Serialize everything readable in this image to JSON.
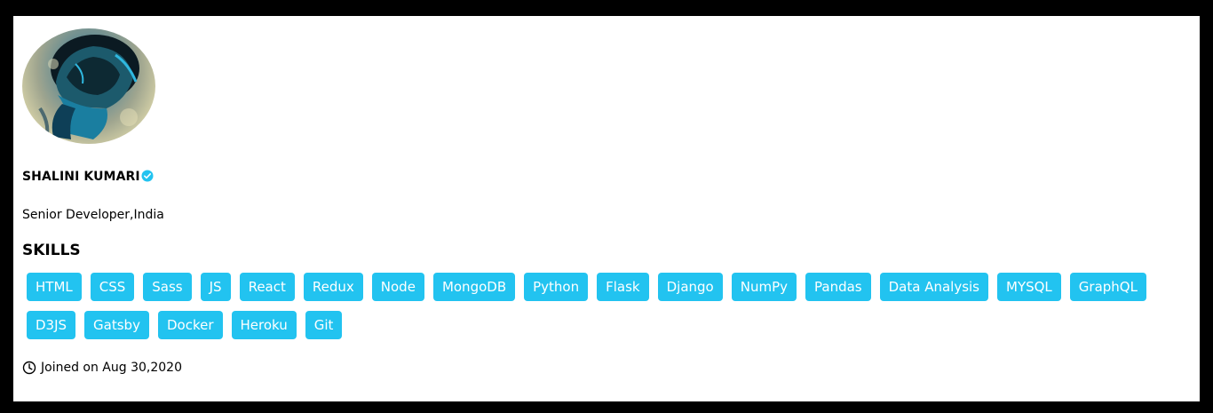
{
  "profile": {
    "name": "SHALINI KUMARI",
    "subtitle": "Senior Developer,India",
    "verified_icon": "verified-check-icon",
    "avatar_icon": "hooded-figure-avatar",
    "skills_title": "SKILLS",
    "skills": [
      "HTML",
      "CSS",
      "Sass",
      "JS",
      "React",
      "Redux",
      "Node",
      "MongoDB",
      "Python",
      "Flask",
      "Django",
      "NumPy",
      "Pandas",
      "Data Analysis",
      "MYSQL",
      "GraphQL",
      "D3JS",
      "Gatsby",
      "Docker",
      "Heroku",
      "Git"
    ],
    "joined_icon": "clock-icon",
    "joined_text": "Joined on Aug 30,2020"
  },
  "colors": {
    "frame": "#000000",
    "card": "#ffffff",
    "skill_badge": "#22c3f0",
    "verified": "#1da1f2"
  }
}
